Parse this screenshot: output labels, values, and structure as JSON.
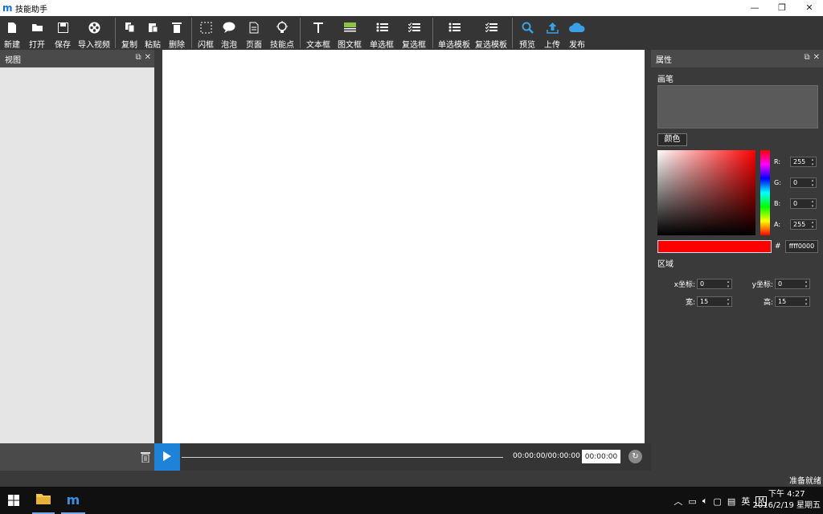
{
  "window": {
    "title": "技能助手",
    "logo": "m",
    "minimize": "—",
    "restore": "❐",
    "close": "✕"
  },
  "toolbar": {
    "new": "新建",
    "open": "打开",
    "save": "保存",
    "import_video": "导入视频",
    "copy": "复制",
    "paste": "粘贴",
    "delete": "删除",
    "flash_frame": "闪框",
    "bubble": "泡泡",
    "page": "页面",
    "skill_point": "技能点",
    "text_box": "文本框",
    "image_text_box": "图文框",
    "single_select_box": "单选框",
    "multi_select_box": "复选框",
    "single_select_template": "单选模板",
    "multi_select_template": "复选模板",
    "preview": "预览",
    "upload": "上传",
    "publish": "发布"
  },
  "left_panel": {
    "title": "视图",
    "float": "⧉",
    "close": "✕"
  },
  "timeline": {
    "time": "00:00:00/00:00:00",
    "time_box": "00:00:00",
    "progress": 0
  },
  "right_panel": {
    "title": "属性",
    "float": "⧉",
    "close": "✕",
    "brush_label": "画笔",
    "color_button": "颜色",
    "r_label": "R:",
    "r_value": "255",
    "g_label": "G:",
    "g_value": "0",
    "b_label": "B:",
    "b_value": "0",
    "a_label": "A:",
    "a_value": "255",
    "hash": "#",
    "hex_value": "ffff0000",
    "region_label": "区域",
    "x_label": "x坐标:",
    "x_value": "0",
    "y_label": "y坐标:",
    "y_value": "0",
    "w_label": "宽:",
    "w_value": "15",
    "h_label": "高:",
    "h_value": "15",
    "current_color": "#ff0000"
  },
  "status": {
    "text": "准备就绪"
  },
  "taskbar": {
    "ime": "英",
    "ime_mode": "M",
    "time": "下午 4:27",
    "date": "2016/2/19 星期五"
  }
}
